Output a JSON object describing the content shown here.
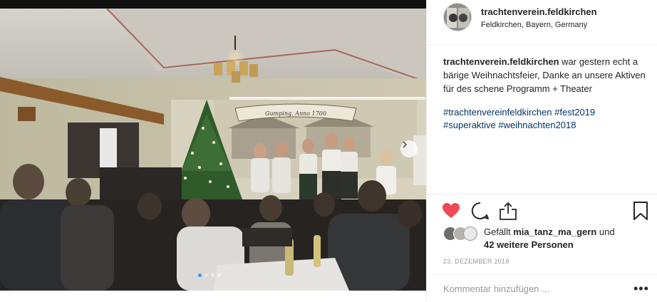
{
  "post": {
    "username": "trachtenverein.feldkirchen",
    "location": "Feldkirchen, Bayern, Germany",
    "caption_text": " war gestern echt a bärige Weihnachtsfeier, Danke an unsere Aktiven für des schene Programm + Theater",
    "hashtags": [
      "#trachtenvereinfeldkirchen",
      "#fest2019",
      "#superaktive",
      "#weihnachten2018"
    ],
    "liked_by_prefix": "Gefällt ",
    "liked_by_user": "mia_tanz_ma_gern",
    "liked_by_and": " und",
    "liked_by_others": "42 weitere Personen",
    "date": "23. DEZEMBER 2018",
    "liked": true
  },
  "photo": {
    "banner_text": "Gumping. Anno 1700",
    "carousel_count": 4,
    "carousel_active": 0
  },
  "comment": {
    "placeholder": "Kommentar hinzufügen ...",
    "more_label": "•••"
  },
  "colors": {
    "like": "#ed4956",
    "hashtag": "#003569",
    "carousel_active": "#3897f0"
  },
  "icons": {
    "like": "heart-icon",
    "comment": "comment-icon",
    "share": "share-icon",
    "save": "bookmark-icon",
    "next": "chevron-right-icon"
  }
}
